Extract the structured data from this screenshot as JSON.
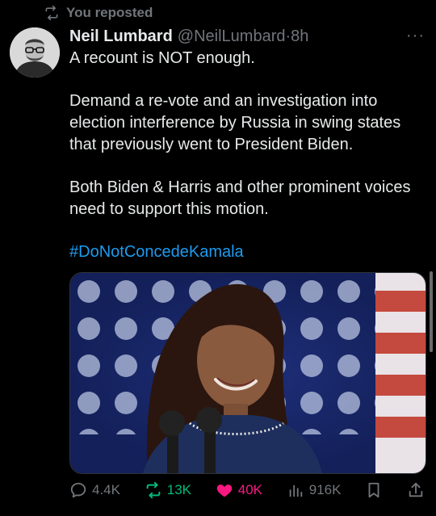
{
  "repost_banner": {
    "text": "You reposted",
    "icon": "repost-icon"
  },
  "post": {
    "display_name": "Neil Lumbard",
    "handle": "@NeilLumbard",
    "separator": "·",
    "time": "8h",
    "more_icon": "more-icon",
    "more_label": "···",
    "paragraphs": [
      "A recount is NOT enough.",
      "Demand a re-vote and an investigation into election interference by Russia in swing states that previously went to President Biden.",
      "Both Biden & Harris and other prominent voices need to support this motion."
    ],
    "hashtag": "#DoNotConcedeKamala"
  },
  "actions": {
    "replies": "4.4K",
    "reposts": "13K",
    "likes": "40K",
    "views": "916K"
  },
  "colors": {
    "background": "#000000",
    "text": "#e7e9ea",
    "muted": "#71767b",
    "link": "#1d9bf0",
    "repost_active": "#00ba7c",
    "like_active": "#f91880"
  }
}
